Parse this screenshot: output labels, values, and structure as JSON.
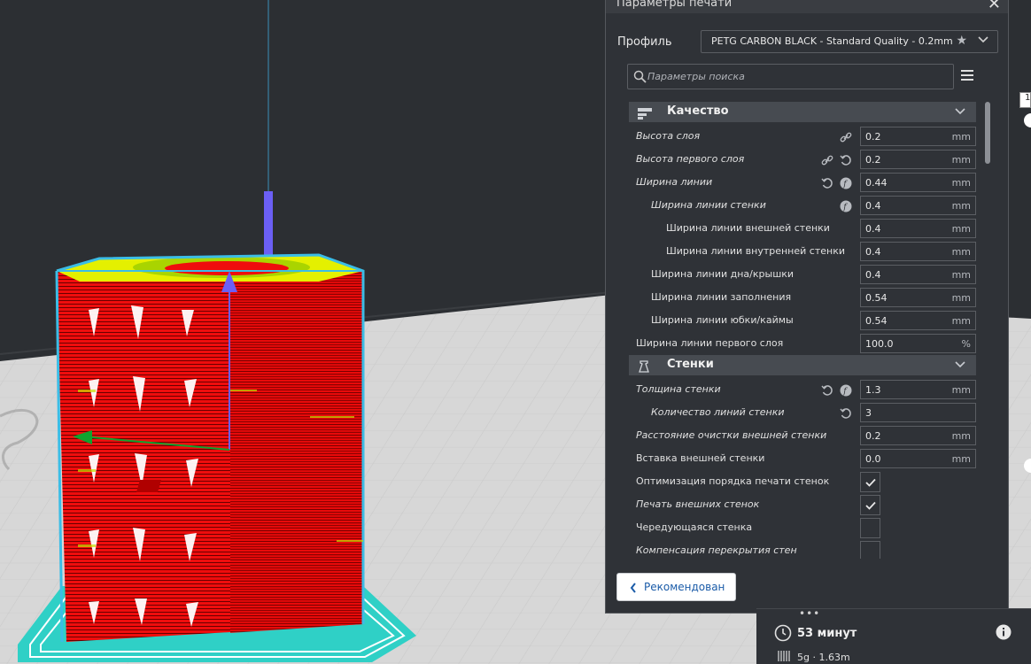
{
  "panel": {
    "title": "Параметры печати",
    "profile_label": "Профиль",
    "profile_value": "PETG CARBON BLACK - Standard Quality - 0.2mm",
    "search_placeholder": "Параметры поиска",
    "close_icon": "close-icon",
    "menu_icon": "hamburger-menu-icon"
  },
  "categories": [
    {
      "title": "Качество",
      "icon": "quality-icon",
      "rows": [
        {
          "label": "Высота слоя",
          "italic": true,
          "indent": 0,
          "value": "0.2",
          "unit": "mm",
          "icons": [
            "link-icon"
          ]
        },
        {
          "label": "Высота первого слоя",
          "italic": true,
          "indent": 0,
          "value": "0.2",
          "unit": "mm",
          "icons": [
            "link-icon",
            "reset-icon"
          ]
        },
        {
          "label": "Ширина линии",
          "italic": true,
          "indent": 0,
          "value": "0.44",
          "unit": "mm",
          "icons": [
            "reset-icon",
            "function-icon"
          ]
        },
        {
          "label": "Ширина линии стенки",
          "italic": true,
          "indent": 1,
          "value": "0.4",
          "unit": "mm",
          "icons": [
            "function-icon"
          ]
        },
        {
          "label": "Ширина линии внешней стенки",
          "italic": false,
          "indent": 2,
          "value": "0.4",
          "unit": "mm",
          "icons": []
        },
        {
          "label": "Ширина линии внутренней стенки",
          "italic": false,
          "indent": 2,
          "value": "0.4",
          "unit": "mm",
          "icons": []
        },
        {
          "label": "Ширина линии дна/крышки",
          "italic": false,
          "indent": 1,
          "value": "0.4",
          "unit": "mm",
          "icons": []
        },
        {
          "label": "Ширина линии заполнения",
          "italic": false,
          "indent": 1,
          "value": "0.54",
          "unit": "mm",
          "icons": []
        },
        {
          "label": "Ширина линии юбки/каймы",
          "italic": false,
          "indent": 1,
          "value": "0.54",
          "unit": "mm",
          "icons": []
        },
        {
          "label": "Ширина линии первого слоя",
          "italic": false,
          "indent": 0,
          "value": "100.0",
          "unit": "%",
          "icons": []
        }
      ]
    },
    {
      "title": "Стенки",
      "icon": "walls-icon",
      "rows": [
        {
          "label": "Толщина стенки",
          "italic": true,
          "indent": 0,
          "value": "1.3",
          "unit": "mm",
          "icons": [
            "reset-icon",
            "function-icon"
          ]
        },
        {
          "label": "Количество линий стенки",
          "italic": true,
          "indent": 1,
          "value": "3",
          "unit": "",
          "icons": [
            "reset-icon"
          ]
        },
        {
          "label": "Расстояние очистки внешней стенки",
          "italic": true,
          "indent": 0,
          "value": "0.2",
          "unit": "mm",
          "icons": []
        },
        {
          "label": "Вставка внешней стенки",
          "italic": false,
          "indent": 0,
          "value": "0.0",
          "unit": "mm",
          "icons": []
        },
        {
          "label": "Оптимизация порядка печати стенок",
          "italic": false,
          "indent": 0,
          "checkbox": true,
          "checked": true,
          "icons": []
        },
        {
          "label": "Печать внешних стенок",
          "italic": true,
          "indent": 0,
          "checkbox": true,
          "checked": true,
          "icons": []
        },
        {
          "label": "Чередующаяся стенка",
          "italic": false,
          "indent": 0,
          "checkbox": true,
          "checked": false,
          "icons": []
        },
        {
          "label": "Компенсация перекрытия стен",
          "italic": true,
          "indent": 0,
          "checkbox": true,
          "checked": false,
          "icons": []
        }
      ]
    }
  ],
  "footer": {
    "recommended_label": "Рекомендован"
  },
  "info": {
    "print_time": "53 минут",
    "material": "5g · 1.63m"
  },
  "edge_tag": "1",
  "colors": {
    "panel_bg": "#2f3237",
    "category_bg": "#474b51",
    "accent_blue": "#1a5ba8",
    "model_red": "#ef0d0d",
    "outline_cyan": "#3bbde6",
    "skirt_teal": "#2fd0c6"
  }
}
